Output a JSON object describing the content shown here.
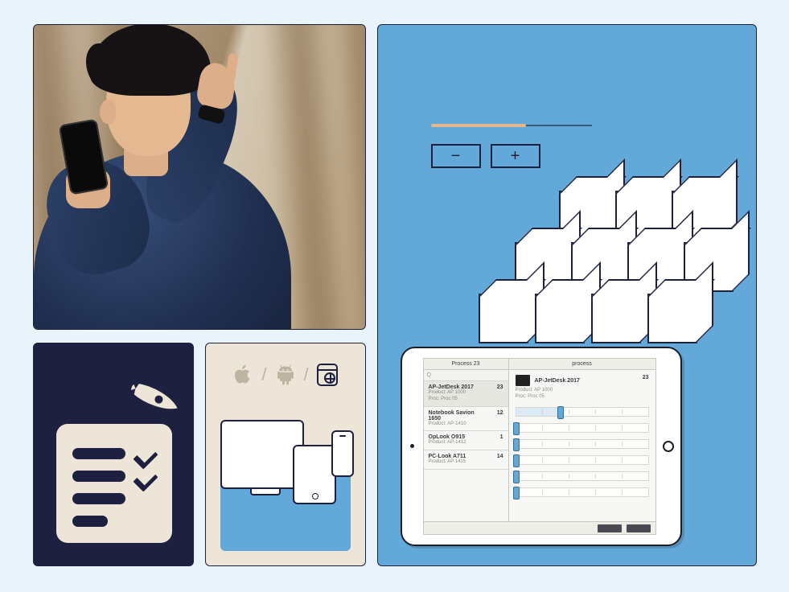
{
  "photo": {
    "alt": "Man in a warehouse holding a smartphone and pointing at shelves"
  },
  "logo": {
    "name": "Rocket Inventory app icon",
    "checklist_lines": 4
  },
  "platforms": {
    "items": [
      "apple-icon",
      "android-icon",
      "web-browser-icon"
    ],
    "separator": "/"
  },
  "right_panel": {
    "progress_percent": 58,
    "decrement_label": "−",
    "increment_label": "+"
  },
  "tablet": {
    "left_tab": "Process 23",
    "right_tab": "process",
    "search_placeholder": "Q",
    "products": [
      {
        "title": "AP-JetDesk 2017",
        "sub1": "Product: AP 1000",
        "sub2": "Proc: Proc 05",
        "qty": 23,
        "selected": true
      },
      {
        "title": "Notebook Savion 1650",
        "sub1": "Product: AP-1410",
        "sub2": "",
        "qty": 12,
        "selected": false
      },
      {
        "title": "OpLook O915",
        "sub1": "Product: AP-1412",
        "sub2": "",
        "qty": 1,
        "selected": false
      },
      {
        "title": "PC-Look A711",
        "sub1": "Product: AP 1415",
        "sub2": "",
        "qty": 14,
        "selected": false
      }
    ],
    "detail": {
      "title": "AP-JetDesk 2017",
      "qty": 23,
      "sub1": "Product: AP 1000",
      "sub2": "Proc: Proc 05"
    },
    "sliders": [
      {
        "fill_pct": 34,
        "knob_pct": 34
      },
      {
        "fill_pct": 0,
        "knob_pct": 0
      },
      {
        "fill_pct": 0,
        "knob_pct": 0
      },
      {
        "fill_pct": 0,
        "knob_pct": 0
      },
      {
        "fill_pct": 0,
        "knob_pct": 0
      },
      {
        "fill_pct": 0,
        "knob_pct": 0
      }
    ],
    "footer_buttons": 2
  },
  "colors": {
    "page_bg": "#e9f3fb",
    "ink": "#1e2040",
    "paper": "#ede6d8",
    "blue": "#62a8d8",
    "accent": "#e7b78b"
  }
}
